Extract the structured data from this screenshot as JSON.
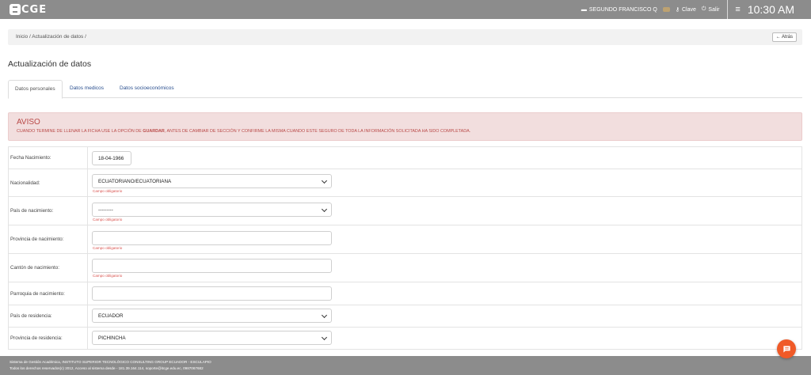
{
  "header": {
    "logo_text": "CGE",
    "user_icon": "graduation-cap-icon",
    "user_name": "SEGUNDO FRANCISCO Q",
    "key_icon": "key-icon",
    "key_label": "Clave",
    "logout_icon": "power-icon",
    "logout_label": "Salir",
    "menu_icon": "hamburger-icon",
    "clock": "10:30 AM"
  },
  "breadcrumb": {
    "text": "Inicio / Actualización de datos /",
    "back_label": "← Atrás"
  },
  "page_title": "Actualización de datos",
  "tabs": [
    {
      "label": "Datos personales",
      "active": true
    },
    {
      "label": "Datos medicos",
      "active": false
    },
    {
      "label": "Datos socioeconómicos",
      "active": false
    }
  ],
  "alert": {
    "title": "AVISO",
    "message_before": "CUANDO TERMINE DE LLENAR LA FICHA USE LA OPCIÓN DE ",
    "message_bold": "GUARDAR",
    "message_after": ", ANTES DE CAMBIAR DE SECCIÓN Y CONFIRME LA MISMA CUANDO ESTE SEGURO DE TODA LA INFORMACIÓN SOLICITADA HA SIDO COMPLETADA."
  },
  "form": {
    "required_text": "Campo obligatorio",
    "rows": [
      {
        "label": "Fecha Nacimiento:",
        "value": "18-04-1966",
        "type": "date"
      },
      {
        "label": "Nacionalidad:",
        "value": "ECUATORIANO/ECUATORIANA",
        "type": "select",
        "error": true
      },
      {
        "label": "País de nacimiento:",
        "value": "---------",
        "type": "select",
        "error": true
      },
      {
        "label": "Provincia de nacimiento:",
        "value": "",
        "type": "text",
        "error": true
      },
      {
        "label": "Cantón de nacimiento:",
        "value": "",
        "type": "text",
        "error": true
      },
      {
        "label": "Parroquia de nacimiento:",
        "value": "",
        "type": "text"
      },
      {
        "label": "País de residencia:",
        "value": "ECUADOR",
        "type": "select"
      },
      {
        "label": "Provincia de residencia:",
        "value": "PICHINCHA",
        "type": "select"
      }
    ]
  },
  "footer": {
    "line1": "Sistema de Gestión Académica, INSTITUTO SUPERIOR TECNOLÓGICO CONSULTING GROUP ECUADOR - ESCULAPIO",
    "line2": "Todos los derechos reservados(c) 2012, Acceso al sistema desde - 181.39.164.114, soporte@itcge.edu.ec, 0987067682"
  },
  "chat": {
    "icon": "chat-bubble-icon",
    "color": "#f05a28"
  },
  "colors": {
    "topbar": "#8c8c8c",
    "alert_bg": "#f2dede",
    "alert_text": "#b94a48",
    "link": "#2a4f8f",
    "error": "#d9534f"
  }
}
